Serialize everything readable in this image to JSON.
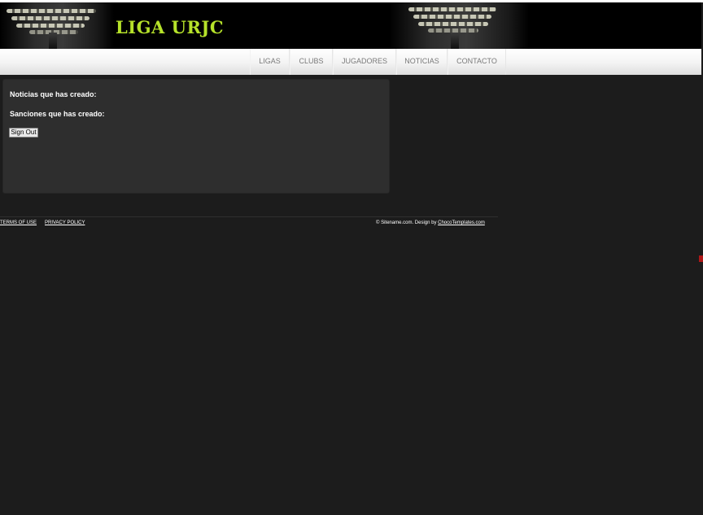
{
  "header": {
    "site_title": "LIGA URJC"
  },
  "nav": {
    "items": [
      {
        "label": "LIGAS"
      },
      {
        "label": "CLUBS"
      },
      {
        "label": "JUGADORES"
      },
      {
        "label": "NOTICIAS"
      },
      {
        "label": "CONTACTO"
      }
    ]
  },
  "panel": {
    "news_heading": "Noticias que has creado:",
    "sanctions_heading": "Sanciones que has creado:",
    "signout_label": "Sign Out"
  },
  "footer": {
    "terms_label": "TERMS OF USE",
    "privacy_label": "PRIVACY POLICY",
    "credit_prefix": "© Sitename.com. Design by",
    "credit_link": "ChocoTemplates.com"
  },
  "colors": {
    "logo_accent": "#b6e22a",
    "page_background": "#1c1c1c",
    "panel_background": "#2e2e2e",
    "nav_text": "#7a7a7a"
  }
}
